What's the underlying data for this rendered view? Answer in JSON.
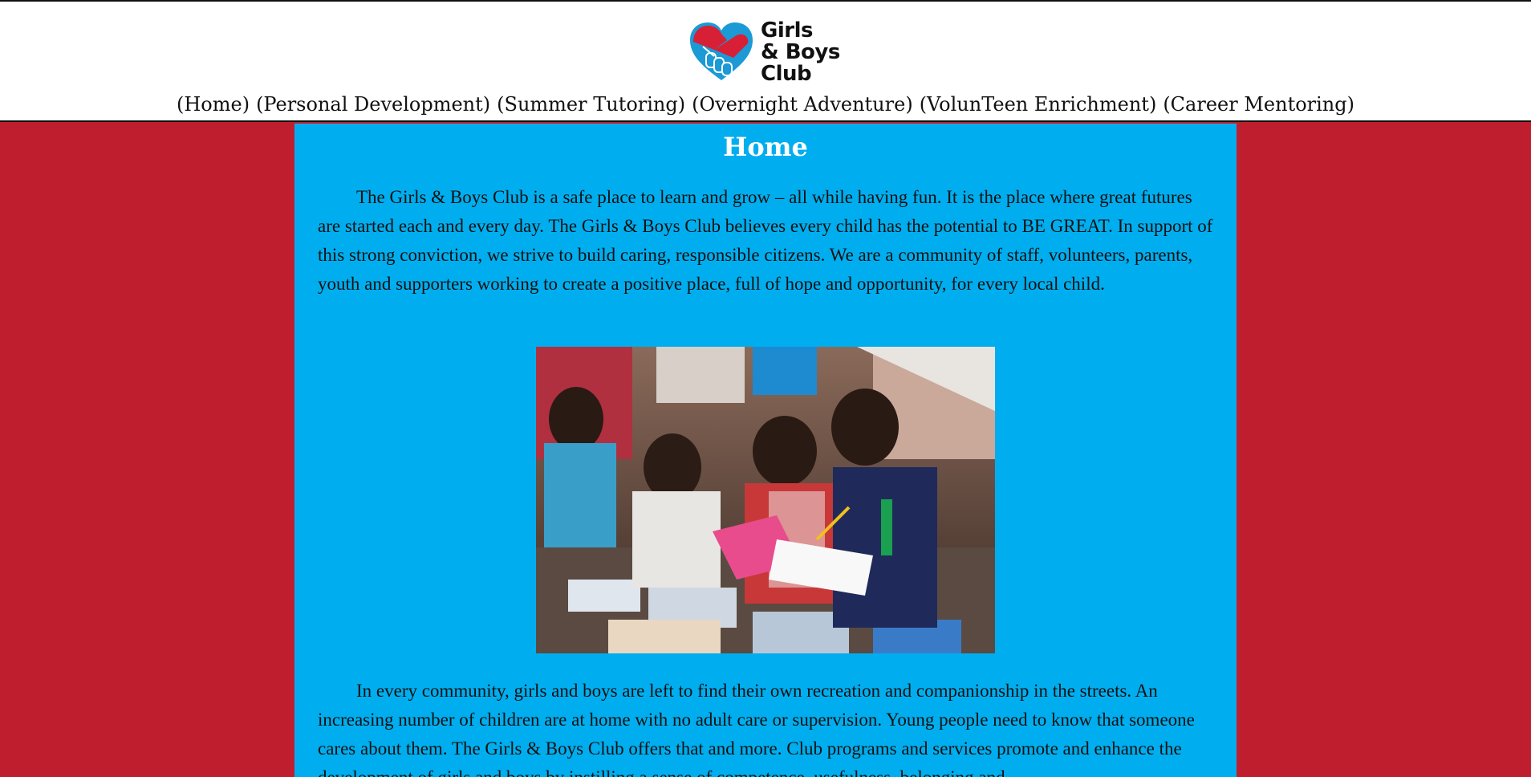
{
  "header": {
    "logo": {
      "icon": "handshake-heart-icon",
      "line1": "Girls",
      "line2": "& Boys",
      "line3": "Club"
    },
    "nav": [
      {
        "label": "(Home)"
      },
      {
        "label": "(Personal Development)"
      },
      {
        "label": "(Summer Tutoring)"
      },
      {
        "label": "(Overnight Adventure)"
      },
      {
        "label": "(VolunTeen Enrichment)"
      },
      {
        "label": "(Career Mentoring)"
      }
    ]
  },
  "main": {
    "title": "Home",
    "paragraph1": "The Girls & Boys Club is a safe place to learn and grow – all while having fun. It is the place where great futures are started each and every day. The Girls & Boys Club believes every child has the potential to BE GREAT. In support of this strong conviction, we strive to build caring, responsible citizens. We are a community of staff, volunteers, parents, youth and supporters working to create a positive place, full of hope and opportunity, for every local child.",
    "paragraph2": "In every community, girls and boys are left to find their own recreation and companionship in the streets. An increasing number of children are at home with no adult care or supervision. Young people need to know that someone cares about them. The Girls & Boys Club offers that and more. Club programs and services promote and enhance the development of girls and boys by instilling a sense of competence, usefulness, belonging and",
    "photo": {
      "icon": "children-reading-photo"
    }
  },
  "colors": {
    "page_background": "#bf1e2e",
    "content_background": "#00aeef",
    "header_background": "#ffffff",
    "logo_red": "#d71f36",
    "logo_blue": "#1b9ad6"
  }
}
